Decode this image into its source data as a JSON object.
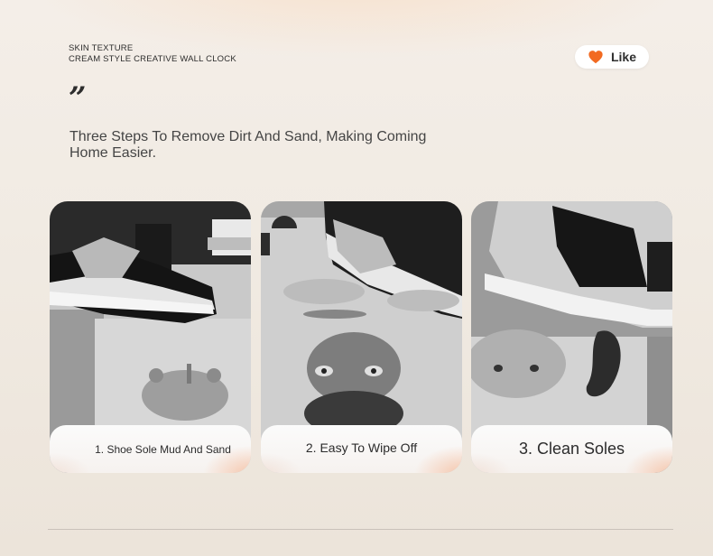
{
  "header": {
    "line1": "SKIN TEXTURE",
    "line2": "CREAM STYLE CREATIVE WALL CLOCK"
  },
  "like": {
    "label": "Like",
    "icon": "heart-icon",
    "icon_color": "#f26a21"
  },
  "quote": {
    "mark": "”",
    "headline": "Three Steps To Remove Dirt And Sand, Making Coming Home Easier."
  },
  "steps": [
    {
      "caption": "1. Shoe Sole Mud And Sand"
    },
    {
      "caption": "2. Easy To Wipe Off"
    },
    {
      "caption": "3. Clean Soles"
    }
  ],
  "colors": {
    "background": "#f1ebe3",
    "accent_glow": "#f4a478",
    "text": "#454545"
  }
}
